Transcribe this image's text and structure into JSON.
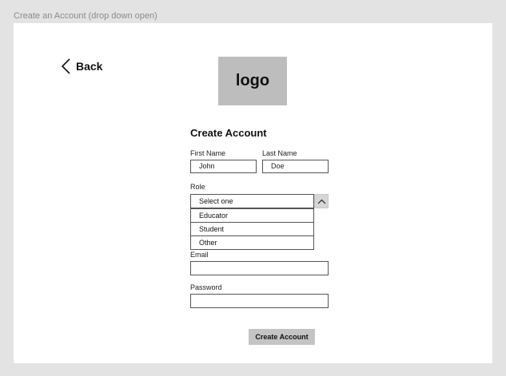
{
  "frame": {
    "label": "Create an Account (drop down open)"
  },
  "nav": {
    "back_label": "Back"
  },
  "logo": {
    "text": "logo"
  },
  "form": {
    "title": "Create Account",
    "first_name": {
      "label": "First Name",
      "value": "John"
    },
    "last_name": {
      "label": "Last Name",
      "value": "Doe"
    },
    "role": {
      "label": "Role",
      "selected": "Select one",
      "options": [
        "Educator",
        "Student",
        "Other"
      ]
    },
    "email": {
      "label": "Email",
      "value": ""
    },
    "password": {
      "label": "Password",
      "value": ""
    },
    "submit_label": "Create Account"
  },
  "icons": {
    "back": "chevron-left-icon",
    "dropdown": "chevron-up-icon"
  },
  "colors": {
    "background": "#e3e3e3",
    "artboard": "#ffffff",
    "placeholder_gray": "#bdbdbd",
    "button_gray": "#c4c4c4"
  }
}
